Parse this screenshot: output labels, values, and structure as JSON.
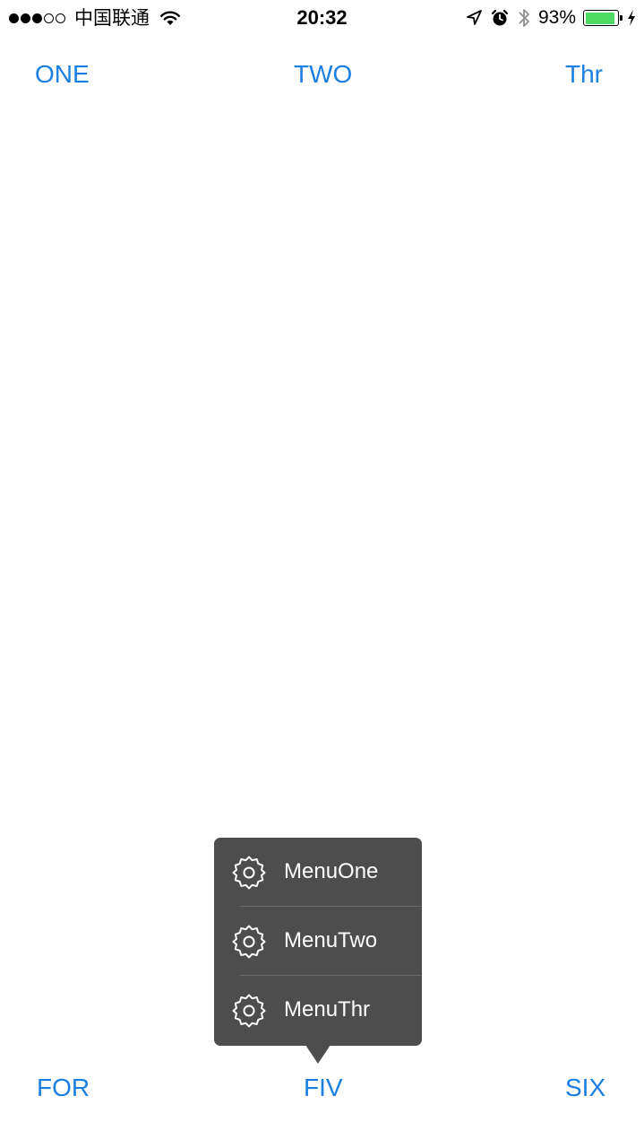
{
  "status_bar": {
    "signal_filled": 3,
    "signal_total": 5,
    "carrier": "中国联通",
    "time": "20:32",
    "battery_percent": "93%",
    "battery_level": 0.93,
    "icons": [
      "wifi-icon",
      "location-arrow-icon",
      "alarm-icon",
      "bluetooth-icon",
      "battery-icon",
      "charging-bolt-icon"
    ]
  },
  "buttons": {
    "top_left": "ONE",
    "top_center": "TWO",
    "top_right": "Thr",
    "bottom_left": "FOR",
    "bottom_center": "FIV",
    "bottom_right": "SIX"
  },
  "popover_menu": {
    "items": [
      {
        "label": "MenuOne",
        "icon": "gear-icon"
      },
      {
        "label": "MenuTwo",
        "icon": "gear-icon"
      },
      {
        "label": "MenuThr",
        "icon": "gear-icon"
      }
    ]
  },
  "colors": {
    "button_text": "#1a7fe0",
    "popover_bg": "#4d4d4d",
    "battery_fill": "#4cd964"
  }
}
